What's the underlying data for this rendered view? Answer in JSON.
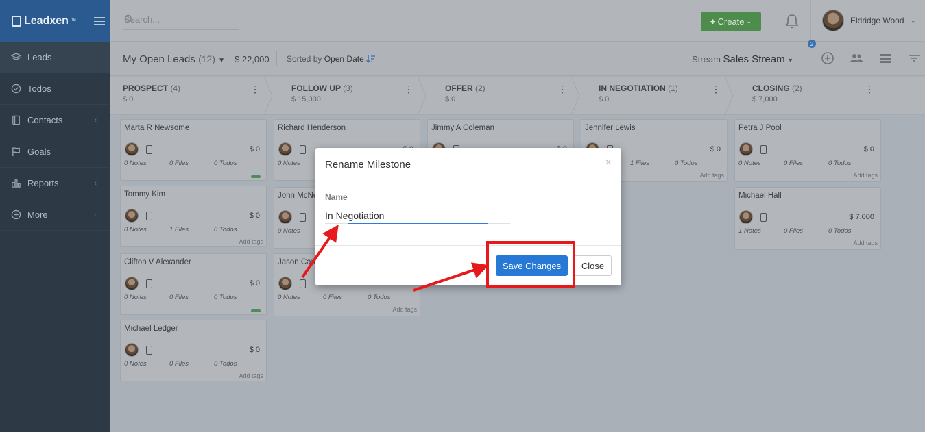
{
  "brand": {
    "name": "Leadxen",
    "tm": "™"
  },
  "sidebar": {
    "items": [
      {
        "label": "Leads",
        "icon": "layers-icon",
        "active": true,
        "chevron": false
      },
      {
        "label": "Todos",
        "icon": "check-circle-icon",
        "active": false,
        "chevron": false
      },
      {
        "label": "Contacts",
        "icon": "book-icon",
        "active": false,
        "chevron": true
      },
      {
        "label": "Goals",
        "icon": "flag-icon",
        "active": false,
        "chevron": false
      },
      {
        "label": "Reports",
        "icon": "bar-chart-icon",
        "active": false,
        "chevron": true
      },
      {
        "label": "More",
        "icon": "plus-circle-icon",
        "active": false,
        "chevron": true
      }
    ]
  },
  "topbar": {
    "search_placeholder": "Search...",
    "create_label": "Create",
    "user_name": "Eldridge Wood"
  },
  "subheader": {
    "title": "My Open Leads",
    "count": "(12)",
    "amount": "$ 22,000",
    "sorted_prefix": "Sorted by",
    "sorted_field": "Open Date",
    "stream_prefix": "Stream",
    "stream_name": "Sales Stream",
    "filter_badge": "2"
  },
  "stages": [
    {
      "name": "PROSPECT",
      "count": "(4)",
      "amount": "$ 0"
    },
    {
      "name": "FOLLOW UP",
      "count": "(3)",
      "amount": "$ 15,000"
    },
    {
      "name": "OFFER",
      "count": "(2)",
      "amount": "$ 0"
    },
    {
      "name": "IN NEGOTIATION",
      "count": "(1)",
      "amount": "$ 0"
    },
    {
      "name": "CLOSING",
      "count": "(2)",
      "amount": "$ 7,000"
    }
  ],
  "cards": [
    {
      "name": "Marta R Newsome",
      "value": "$ 0",
      "notes": "0 Notes",
      "files": "0 Files",
      "todos": "0 Todos",
      "tags": "",
      "bar": true
    },
    {
      "name": "Tommy Kim",
      "value": "$ 0",
      "notes": "0 Notes",
      "files": "1 Files",
      "todos": "0 Todos",
      "tags": "Add tags",
      "bar": false
    },
    {
      "name": "Clifton V Alexander",
      "value": "$ 0",
      "notes": "0 Notes",
      "files": "0 Files",
      "todos": "0 Todos",
      "tags": "",
      "bar": true
    },
    {
      "name": "Michael Ledger",
      "value": "$ 0",
      "notes": "0 Notes",
      "files": "0 Files",
      "todos": "0 Todos",
      "tags": "Add tags",
      "bar": false
    },
    {
      "name": "Richard Henderson",
      "value": "$ 0",
      "notes": "0 Notes",
      "files": "",
      "todos": "",
      "tags": "",
      "bar": false
    },
    {
      "name": "John McNe",
      "value": "",
      "notes": "0 Notes",
      "files": "",
      "todos": "",
      "tags": "",
      "bar": false
    },
    {
      "name": "Jason Carr",
      "value": "",
      "notes": "0 Notes",
      "files": "0 Files",
      "todos": "0 Todos",
      "tags": "Add tags",
      "bar": false
    },
    {
      "name": "Jimmy A Coleman",
      "value": "$ 0",
      "notes": "",
      "files": "",
      "todos": "",
      "tags": "",
      "bar": false
    },
    {
      "name": "Jennifer Lewis",
      "value": "$ 0",
      "notes": "",
      "files": "1 Files",
      "todos": "0 Todos",
      "tags": "Add tags",
      "bar": false
    },
    {
      "name": "Petra J Pool",
      "value": "$ 0",
      "notes": "0 Notes",
      "files": "0 Files",
      "todos": "0 Todos",
      "tags": "Add tags",
      "bar": false
    },
    {
      "name": "Michael Hall",
      "value": "$ 7,000",
      "notes": "1 Notes",
      "files": "0 Files",
      "todos": "0 Todos",
      "tags": "Add tags",
      "bar": false
    }
  ],
  "modal": {
    "title": "Rename Milestone",
    "close_x": "×",
    "field_label": "Name",
    "field_value": "In Negotiation",
    "save_label": "Save Changes",
    "close_label": "Close"
  },
  "colors": {
    "annotation_red": "#e8191b",
    "primary_blue": "#2679d4",
    "create_green": "#5cb85c",
    "sidebar_dark": "#2d3944",
    "brand_blue": "#2f6db4"
  }
}
